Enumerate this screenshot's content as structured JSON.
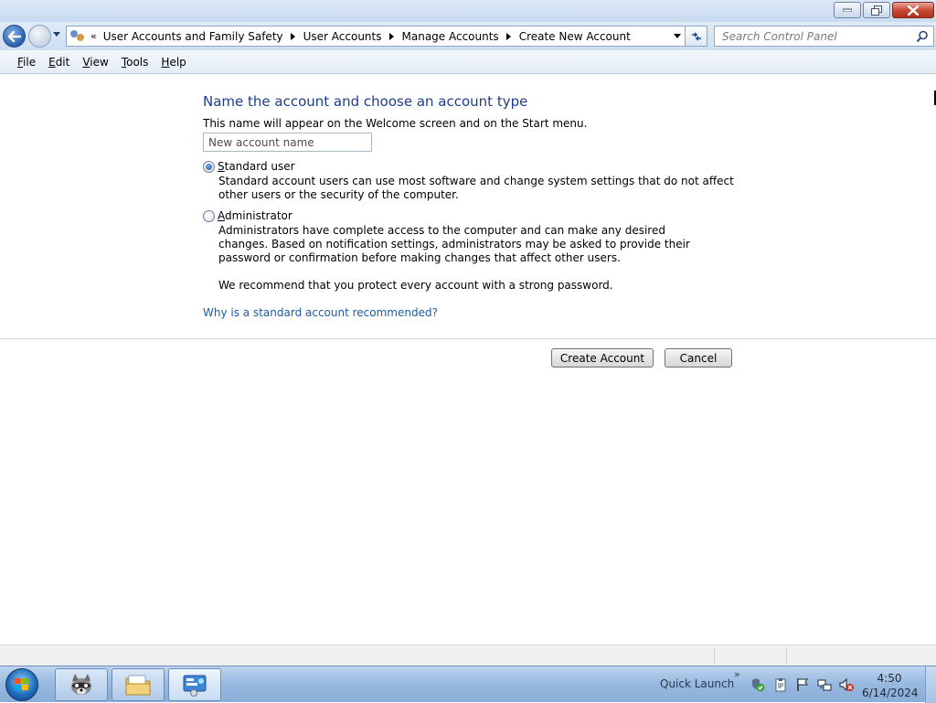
{
  "window": {
    "controls": {
      "minimize_icon": "minimize-icon",
      "maximize_icon": "restore-icon",
      "close_icon": "close-icon"
    }
  },
  "address_bar": {
    "overflow_chevron": "«",
    "crumbs": [
      "User Accounts and Family Safety",
      "User Accounts",
      "Manage Accounts",
      "Create New Account"
    ],
    "icon": "control-panel-icon"
  },
  "search": {
    "placeholder": "Search Control Panel"
  },
  "menu": {
    "file": {
      "accel": "F",
      "rest": "ile"
    },
    "edit": {
      "accel": "E",
      "rest": "dit"
    },
    "view": {
      "accel": "V",
      "rest": "iew"
    },
    "tools": {
      "accel": "T",
      "rest": "ools"
    },
    "help": {
      "accel": "H",
      "rest": "elp"
    }
  },
  "form": {
    "heading": "Name the account and choose an account type",
    "description": "This name will appear on the Welcome screen and on the Start menu.",
    "name_placeholder": "New account name",
    "standard": {
      "accel": "S",
      "label_rest": "tandard user",
      "checked": true,
      "description": "Standard account users can use most software and change system settings that do not affect other users or the security of the computer."
    },
    "administrator": {
      "accel": "A",
      "label_rest": "dministrator",
      "checked": false,
      "description": "Administrators have complete access to the computer and can make any desired changes. Based on notification settings, administrators may be asked to provide their password or confirmation before making changes that affect other users."
    },
    "recommendation": "We recommend that you protect every account with a strong password.",
    "help_link": "Why is a standard account recommended?",
    "create_button": "Create Account",
    "cancel_button": "Cancel"
  },
  "taskbar": {
    "quick_launch": "Quick Launch",
    "quick_launch_chevron": "»",
    "pinned": [
      "raccoon-app-icon",
      "file-explorer-icon",
      "control-panel-icon"
    ],
    "tray": [
      "security-shield-icon",
      "clipboard-icon",
      "flag-icon",
      "network-icon",
      "volume-muted-icon"
    ],
    "time": "4:50",
    "date": "6/14/2024"
  },
  "colors": {
    "heading": "#1e3d8c",
    "link": "#1b5caa",
    "taskbar": "#97b8df"
  }
}
